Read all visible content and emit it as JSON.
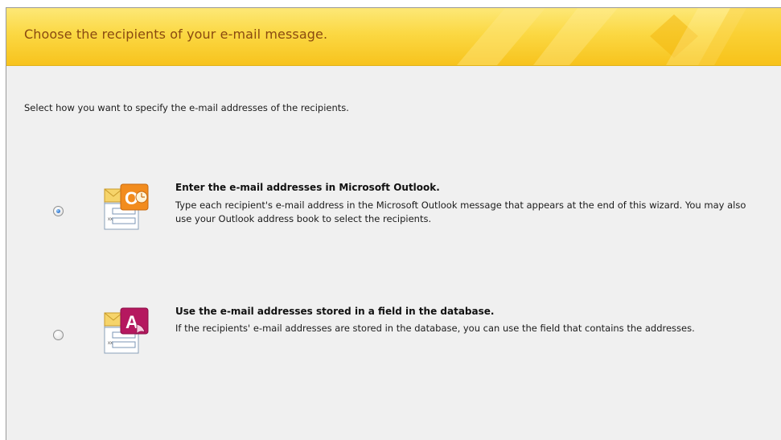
{
  "banner": {
    "title": "Choose the recipients of your e-mail message."
  },
  "instruction": "Select how you want to specify the e-mail addresses of the recipients.",
  "options": [
    {
      "title": "Enter the e-mail addresses in Microsoft Outlook.",
      "description": "Type each recipient's e-mail address in the Microsoft Outlook message that appears at the end of this wizard. You may also use your Outlook address book to select the recipients.",
      "selected": true,
      "icon": "outlook-form-icon"
    },
    {
      "title": "Use the e-mail addresses stored in a field in the database.",
      "description": "If the recipients' e-mail addresses are stored in the database, you can use the field that contains the addresses.",
      "selected": false,
      "icon": "access-form-icon"
    }
  ],
  "icon_text": {
    "form_placeholder": "xxx",
    "outlook_letter": "O",
    "access_letter": "A"
  },
  "colors": {
    "banner_yellow": "#fbd843",
    "banner_title": "#8a4a10",
    "outlook_orange": "#f28c1e",
    "access_magenta": "#b5185f",
    "dialog_bg": "#f0f0f0"
  }
}
